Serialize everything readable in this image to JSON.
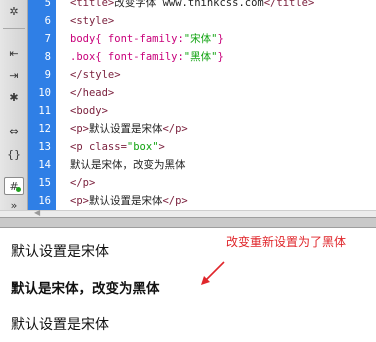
{
  "toolbar": {
    "icons": [
      "settings-icon",
      "align-left-icon",
      "align-right-icon",
      "asterisk-icon",
      "indent-icon",
      "brace-icon",
      "hash-icon",
      "chevron-down-icon"
    ]
  },
  "editor": {
    "lines": [
      {
        "num": "5",
        "segments": [
          {
            "t": "<title>",
            "c": "c-tag"
          },
          {
            "t": "改变字体 www.thinkcss.com",
            "c": "c-txt"
          },
          {
            "t": "</title>",
            "c": "c-tag"
          }
        ]
      },
      {
        "num": "6",
        "segments": [
          {
            "t": "<style>",
            "c": "c-tag"
          }
        ]
      },
      {
        "num": "7",
        "segments": [
          {
            "t": "body{ font-family:",
            "c": "c-css"
          },
          {
            "t": "\"宋体\"",
            "c": "c-str"
          },
          {
            "t": "}",
            "c": "c-css"
          }
        ]
      },
      {
        "num": "8",
        "segments": [
          {
            "t": ".box{ font-family:",
            "c": "c-css"
          },
          {
            "t": "\"黑体\"",
            "c": "c-str"
          },
          {
            "t": "}",
            "c": "c-css"
          }
        ]
      },
      {
        "num": "9",
        "segments": [
          {
            "t": "</style>",
            "c": "c-tag"
          }
        ]
      },
      {
        "num": "10",
        "segments": [
          {
            "t": "</head>",
            "c": "c-tag"
          }
        ]
      },
      {
        "num": "11",
        "segments": [
          {
            "t": "<body>",
            "c": "c-tag"
          }
        ]
      },
      {
        "num": "12",
        "segments": [
          {
            "t": "<p>",
            "c": "c-tag"
          },
          {
            "t": "默认设置是宋体",
            "c": "c-txt"
          },
          {
            "t": "</p>",
            "c": "c-tag"
          }
        ]
      },
      {
        "num": "13",
        "segments": [
          {
            "t": "<p class=",
            "c": "c-tag"
          },
          {
            "t": "\"box\"",
            "c": "c-str"
          },
          {
            "t": ">",
            "c": "c-tag"
          }
        ]
      },
      {
        "num": "14",
        "segments": [
          {
            "t": "默认是宋体，改变为黑体",
            "c": "c-txt"
          }
        ]
      },
      {
        "num": "15",
        "segments": [
          {
            "t": "</p>",
            "c": "c-tag"
          }
        ]
      },
      {
        "num": "16",
        "segments": [
          {
            "t": "<p>",
            "c": "c-tag"
          },
          {
            "t": "默认设置是宋体",
            "c": "c-txt"
          },
          {
            "t": "</p>",
            "c": "c-tag"
          }
        ]
      }
    ]
  },
  "preview": {
    "line1": "默认设置是宋体",
    "line2": "默认是宋体，改变为黑体",
    "line3": "默认设置是宋体"
  },
  "annotation": {
    "text": "改变重新设置为了黑体",
    "color": "#e0262b"
  },
  "colors": {
    "gutter": "#2f7fe6",
    "tag": "#7a1f3c",
    "string": "#11a311",
    "css": "#c8007a"
  }
}
